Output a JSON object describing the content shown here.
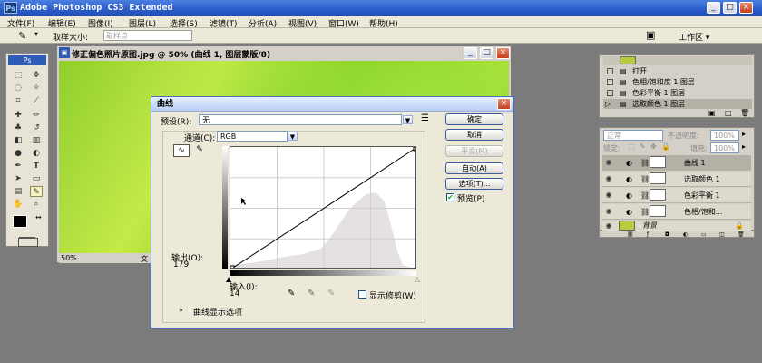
{
  "app": {
    "title": "Adobe Photoshop CS3 Extended",
    "logo": "Ps"
  },
  "window_buttons": [
    "_",
    "□",
    "×"
  ],
  "menu": [
    "文件(F)",
    "编辑(E)",
    "图像(I)",
    "图层(L)",
    "选择(S)",
    "滤镜(T)",
    "分析(A)",
    "视图(V)",
    "窗口(W)",
    "帮助(H)"
  ],
  "options": {
    "sample_size_label": "取样大小:",
    "sample_size_value": "取样点",
    "workspace_label": "工作区 ▾"
  },
  "toolbox": {
    "logo": "Ps"
  },
  "document": {
    "title": "修正偏色照片原图.jpg @ 50% (曲线 1, 图层蒙版/8)",
    "zoom": "50%",
    "status_label": "文"
  },
  "curves": {
    "title": "曲线",
    "preset_label": "预设(R):",
    "preset_value": "无",
    "channel_label": "通道(C):",
    "channel_value": "RGB",
    "output_label": "输出(O):",
    "output_value": "179",
    "input_label": "输入(I):",
    "input_value": "14",
    "show_clipping_label": "显示修剪(W)",
    "expand_options_label": "曲线显示选项",
    "buttons": {
      "ok": "确定",
      "cancel": "取消",
      "smooth": "平滑(M)",
      "auto": "自动(A)",
      "options": "选项(T)...",
      "preview": "预览(P)"
    },
    "preview_checked": true
  },
  "history": {
    "items": [
      "打开",
      "色相/饱和度 1 图层",
      "色彩平衡 1 图层",
      "选取颜色 1 图层"
    ],
    "selected_index": 3
  },
  "layers": {
    "blend_mode": "正常",
    "opacity_label": "不透明度:",
    "opacity_value": "100%",
    "lock_label": "锁定:",
    "fill_label": "填充:",
    "fill_value": "100%",
    "items": [
      {
        "name": "曲线 1"
      },
      {
        "name": "选取颜色 1"
      },
      {
        "name": "色彩平衡 1"
      },
      {
        "name": "色相/饱和..."
      },
      {
        "name": "背景"
      }
    ],
    "selected_index": 0
  }
}
